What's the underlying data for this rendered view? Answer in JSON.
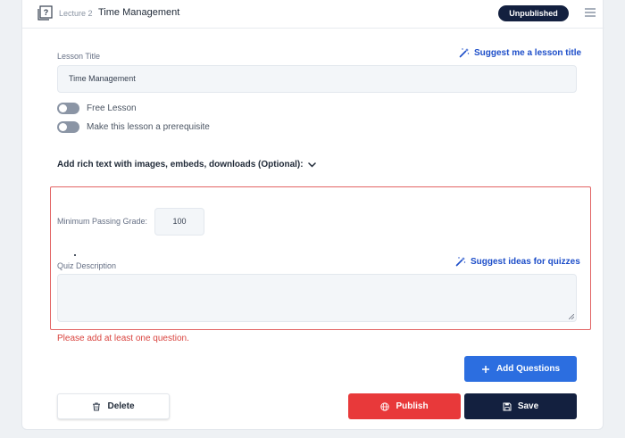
{
  "header": {
    "lecture_number": "Lecture 2",
    "lecture_title": "Time Management",
    "status": "Unpublished"
  },
  "lesson": {
    "title_label": "Lesson Title",
    "suggest_title": "Suggest me a lesson title",
    "title_value": "Time Management",
    "free_lesson_label": "Free Lesson",
    "prerequisite_label": "Make this lesson a prerequisite",
    "rich_text_label": "Add rich text with images, embeds, downloads (Optional):"
  },
  "quiz": {
    "passing_grade_label": "Minimum Passing Grade:",
    "passing_grade_value": "100",
    "description_label": "Quiz Description",
    "suggest_quizzes": "Suggest ideas for quizzes",
    "description_value": ""
  },
  "error": "Please add at least one question.",
  "buttons": {
    "add_questions": "Add Questions",
    "delete": "Delete",
    "publish": "Publish",
    "save": "Save"
  },
  "colors": {
    "primary": "#2c6ee0",
    "navy": "#13203f",
    "danger": "#e8393a",
    "error_text": "#d9443f",
    "link": "#1d4ec9"
  },
  "icons": [
    "quiz-icon",
    "menu-icon",
    "magic-wand-icon",
    "chevron-down-icon",
    "plus-icon",
    "trash-icon",
    "globe-icon",
    "save-icon"
  ]
}
